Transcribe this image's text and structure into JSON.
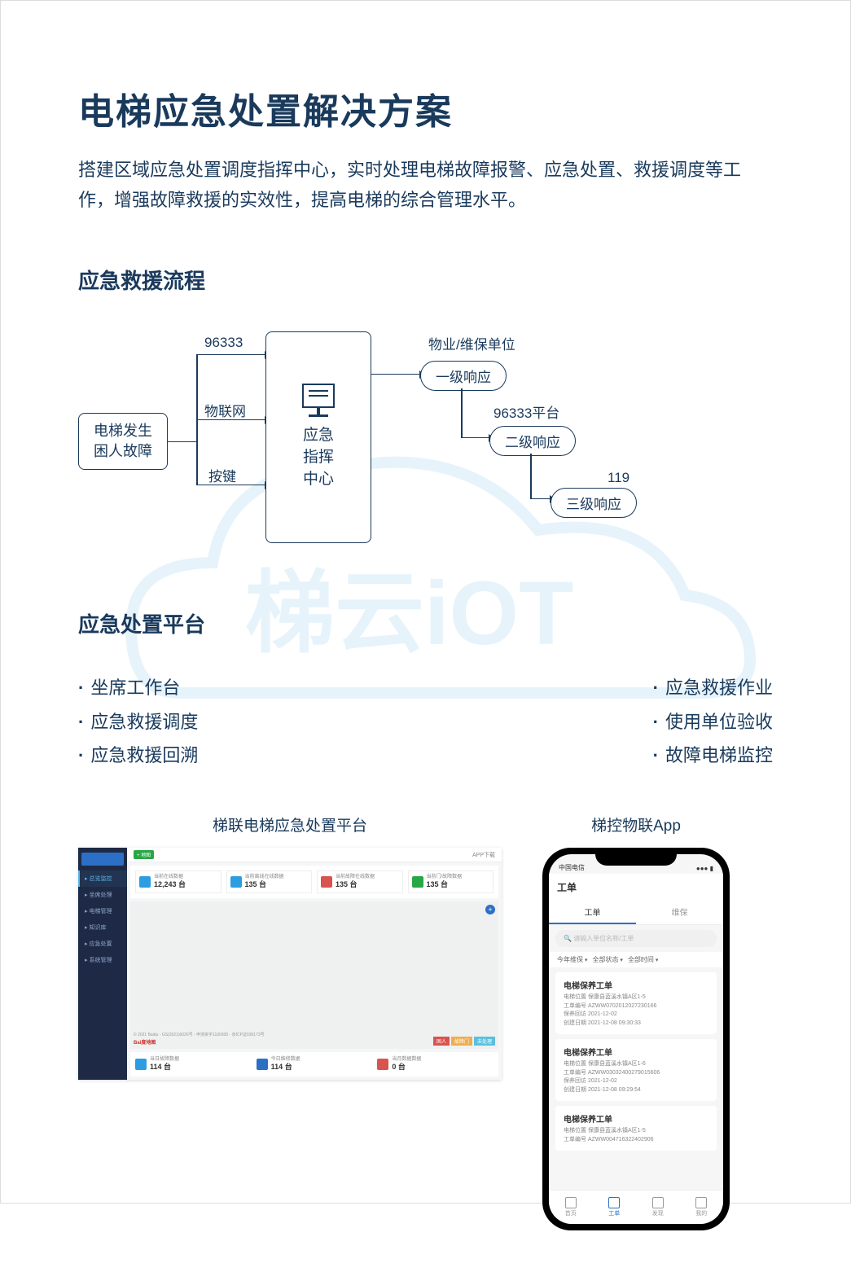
{
  "title": "电梯应急处置解决方案",
  "subtitle": "搭建区域应急处置调度指挥中心，实时处理电梯故障报警、应急处置、救援调度等工作，增强故障救援的实效性，提高电梯的综合管理水平。",
  "section1_title": "应急救援流程",
  "flowchart": {
    "start": "电梯发生\n困人故障",
    "path1": "96333",
    "path2": "物联网",
    "path3": "按键",
    "center": "应急\n指挥\n中心",
    "group1_label": "物业/维保单位",
    "resp1": "一级响应",
    "group2_label": "96333平台",
    "resp2": "二级响应",
    "group3_label": "119",
    "resp3": "三级响应"
  },
  "section2_title": "应急处置平台",
  "features_left": [
    "坐席工作台",
    "应急救援调度",
    "应急救援回溯"
  ],
  "features_right": [
    "应急救援作业",
    "使用单位验收",
    "故障电梯监控"
  ],
  "shot1_title": "梯联电梯应急处置平台",
  "shot2_title": "梯控物联App",
  "dashboard": {
    "header_tag": "+ 地图",
    "header_right": "APP下载",
    "nav": [
      "总览监控",
      "坐席处理",
      "电梯管理",
      "知识库",
      "应急处置",
      "系统管理"
    ],
    "stats": [
      {
        "label": "当前在线数据",
        "value": "12,243 台",
        "color": "#2c9de0"
      },
      {
        "label": "当前离线在线数据",
        "value": "135 台",
        "color": "#2c9de0"
      },
      {
        "label": "当前故障在线数据",
        "value": "135 台",
        "color": "#d9534f"
      },
      {
        "label": "当前门/故障数据",
        "value": "135 台",
        "color": "#28a745"
      }
    ],
    "map_label": "Bai度地图",
    "copyright": "© 2021 Baidu - GS(2021)6026号 - 甲测资字1100930 - 京ICP证030173号",
    "map_tags": [
      "困人",
      "故障门",
      "未处理"
    ],
    "bottom": [
      {
        "label": "当日故障数据",
        "value": "114 台",
        "color": "#2c9de0"
      },
      {
        "label": "今日维修数据",
        "value": "114 台",
        "color": "#2c6fc7"
      },
      {
        "label": "当月数据数据",
        "value": "0 台",
        "color": "#d9534f"
      }
    ]
  },
  "phone": {
    "status_left": "中国电信",
    "page_title": "工单",
    "tabs": [
      "工单",
      "维保"
    ],
    "search_placeholder": "请输入单位名称/工单",
    "filters": [
      "今年维保",
      "全部状态",
      "全部时间"
    ],
    "cards": [
      {
        "title": "电梯保养工单",
        "loc": "电梯位置  保康县蓝溪水镇A区1-5",
        "no": "工单编号  AZWW0702012027230166",
        "date": "保养回访  2021-12-02",
        "time": "创建日期  2021-12-08 09:30:33"
      },
      {
        "title": "电梯保养工单",
        "loc": "电梯位置  保康县蓝溪水镇A区1-6",
        "no": "工单编号  AZWW03032400279015606",
        "date": "保养回访  2021-12-02",
        "time": "创建日期  2021-12-08 09:29:54"
      },
      {
        "title": "电梯保养工单",
        "loc": "电梯位置  保康县蓝溪水镇A区1-5",
        "no": "工单编号  AZWW004716322402906"
      }
    ],
    "nav": [
      "首页",
      "工单",
      "发现",
      "我的"
    ]
  },
  "watermark_text": "梯云iOT"
}
